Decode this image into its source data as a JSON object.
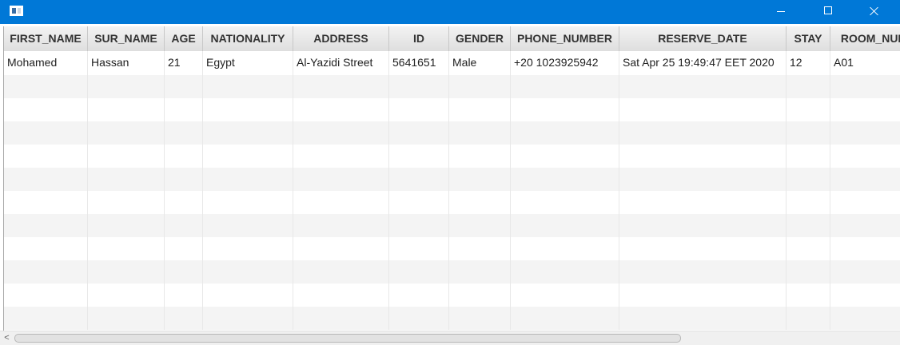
{
  "window": {
    "title": "",
    "icon": "app-window-icon",
    "controls": [
      "minimize-icon",
      "maximize-icon",
      "close-icon"
    ]
  },
  "table": {
    "columns": [
      "FIRST_NAME",
      "SUR_NAME",
      "AGE",
      "NATIONALITY",
      "ADDRESS",
      "ID",
      "GENDER",
      "PHONE_NUMBER",
      "RESERVE_DATE",
      "STAY",
      "ROOM_NUM"
    ],
    "rows": [
      [
        "Mohamed",
        "Hassan",
        "21",
        "Egypt",
        "Al-Yazidi Street",
        "5641651",
        "Male",
        "+20 1023925942",
        "Sat Apr 25 19:49:47 EET 2020",
        "12",
        "A01"
      ]
    ]
  },
  "colors": {
    "titlebar": "#0078d7",
    "header_bg": "#e6e6e6",
    "row_alt": "#f4f4f4"
  },
  "scrollbar": {
    "left_arrow": "<"
  }
}
